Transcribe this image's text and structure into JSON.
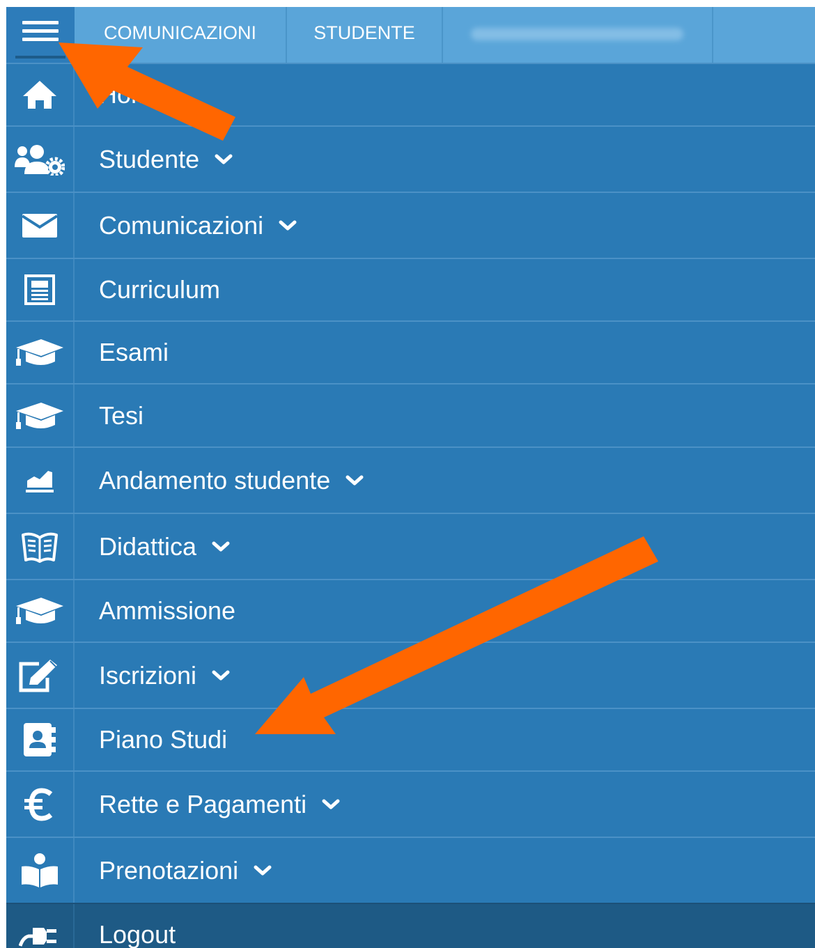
{
  "topbar": {
    "menu_icon": "hamburger-menu-icon",
    "tabs": [
      {
        "label": "COMUNICAZIONI"
      },
      {
        "label": "STUDENTE"
      }
    ]
  },
  "menu": {
    "items": [
      {
        "label": "Home",
        "icon": "home-icon"
      },
      {
        "label": "Studente",
        "icon": "users-cog-icon",
        "has_submenu": true
      },
      {
        "label": "Comunicazioni",
        "icon": "envelope-icon",
        "has_submenu": true
      },
      {
        "label": "Curriculum",
        "icon": "document-icon"
      },
      {
        "label": "Esami",
        "icon": "graduation-cap-icon"
      },
      {
        "label": "Tesi",
        "icon": "graduation-cap-icon"
      },
      {
        "label": "Andamento studente",
        "icon": "area-chart-icon",
        "has_submenu": true
      },
      {
        "label": "Didattica",
        "icon": "open-book-icon",
        "has_submenu": true
      },
      {
        "label": "Ammissione",
        "icon": "graduation-cap-icon"
      },
      {
        "label": "Iscrizioni",
        "icon": "edit-icon",
        "has_submenu": true
      },
      {
        "label": "Piano Studi",
        "icon": "address-book-icon"
      },
      {
        "label": "Rette e Pagamenti",
        "icon": "euro-icon",
        "has_submenu": true
      },
      {
        "label": "Prenotazioni",
        "icon": "reader-icon",
        "has_submenu": true
      },
      {
        "label": "Logout",
        "icon": "plug-icon"
      }
    ]
  },
  "colors": {
    "menu_bg": "#2a7ab5",
    "topbar_bg": "#5aa5d9",
    "logout_bg": "#1e5a85",
    "annotation_arrow": "#ff6600"
  }
}
